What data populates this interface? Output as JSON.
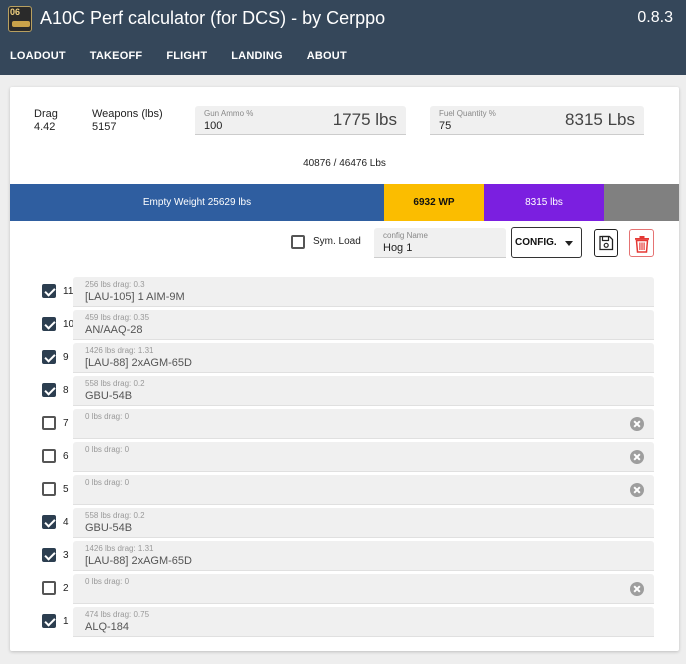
{
  "app": {
    "logo_text": "06",
    "title": "A10C Perf calculator (for DCS) - by Cerppo",
    "version": "0.8.3"
  },
  "nav": [
    {
      "label": "LOADOUT"
    },
    {
      "label": "TAKEOFF"
    },
    {
      "label": "FLIGHT"
    },
    {
      "label": "LANDING"
    },
    {
      "label": "ABOUT"
    }
  ],
  "summary": {
    "drag_label": "Drag",
    "drag_value": "4.42",
    "weapons_label": "Weapons (lbs)",
    "weapons_value": "5157",
    "ammo_label": "Gun Ammo %",
    "ammo_value": "100",
    "ammo_weight": "1775 lbs",
    "fuel_label": "Fuel Quantity %",
    "fuel_value": "75",
    "fuel_weight": "8315 Lbs",
    "total_weight": "40876 / 46476 Lbs"
  },
  "weight_bar": {
    "empty": "Empty Weight 25629 lbs",
    "wp": "6932 WP",
    "fuel": "8315 lbs",
    "colors": {
      "empty": "#2f5ea0",
      "wp": "#fbbd00",
      "fuel": "#7b1fe0",
      "rest": "#808080"
    }
  },
  "config": {
    "sym_load_label": "Sym. Load",
    "sym_load_checked": false,
    "name_label": "config Name",
    "name_value": "Hog 1",
    "select_value": "CONFIG."
  },
  "stations": [
    {
      "num": "11",
      "checked": true,
      "info": "256 lbs drag: 0.3",
      "name": "[LAU-105] 1 AIM-9M",
      "clearable": false
    },
    {
      "num": "10",
      "checked": true,
      "info": "459 lbs drag: 0.35",
      "name": "AN/AAQ-28",
      "clearable": false
    },
    {
      "num": "9",
      "checked": true,
      "info": "1426 lbs drag: 1.31",
      "name": "[LAU-88] 2xAGM-65D",
      "clearable": false
    },
    {
      "num": "8",
      "checked": true,
      "info": "558 lbs drag: 0.2",
      "name": "GBU-54B",
      "clearable": false
    },
    {
      "num": "7",
      "checked": false,
      "info": "0 lbs drag: 0",
      "name": "",
      "clearable": true
    },
    {
      "num": "6",
      "checked": false,
      "info": "0 lbs drag: 0",
      "name": "",
      "clearable": true
    },
    {
      "num": "5",
      "checked": false,
      "info": "0 lbs drag: 0",
      "name": "",
      "clearable": true
    },
    {
      "num": "4",
      "checked": true,
      "info": "558 lbs drag: 0.2",
      "name": "GBU-54B",
      "clearable": false
    },
    {
      "num": "3",
      "checked": true,
      "info": "1426 lbs drag: 1.31",
      "name": "[LAU-88] 2xAGM-65D",
      "clearable": false
    },
    {
      "num": "2",
      "checked": false,
      "info": "0 lbs drag: 0",
      "name": "",
      "clearable": true
    },
    {
      "num": "1",
      "checked": true,
      "info": "474 lbs drag: 0.75",
      "name": "ALQ-184",
      "clearable": false
    }
  ]
}
